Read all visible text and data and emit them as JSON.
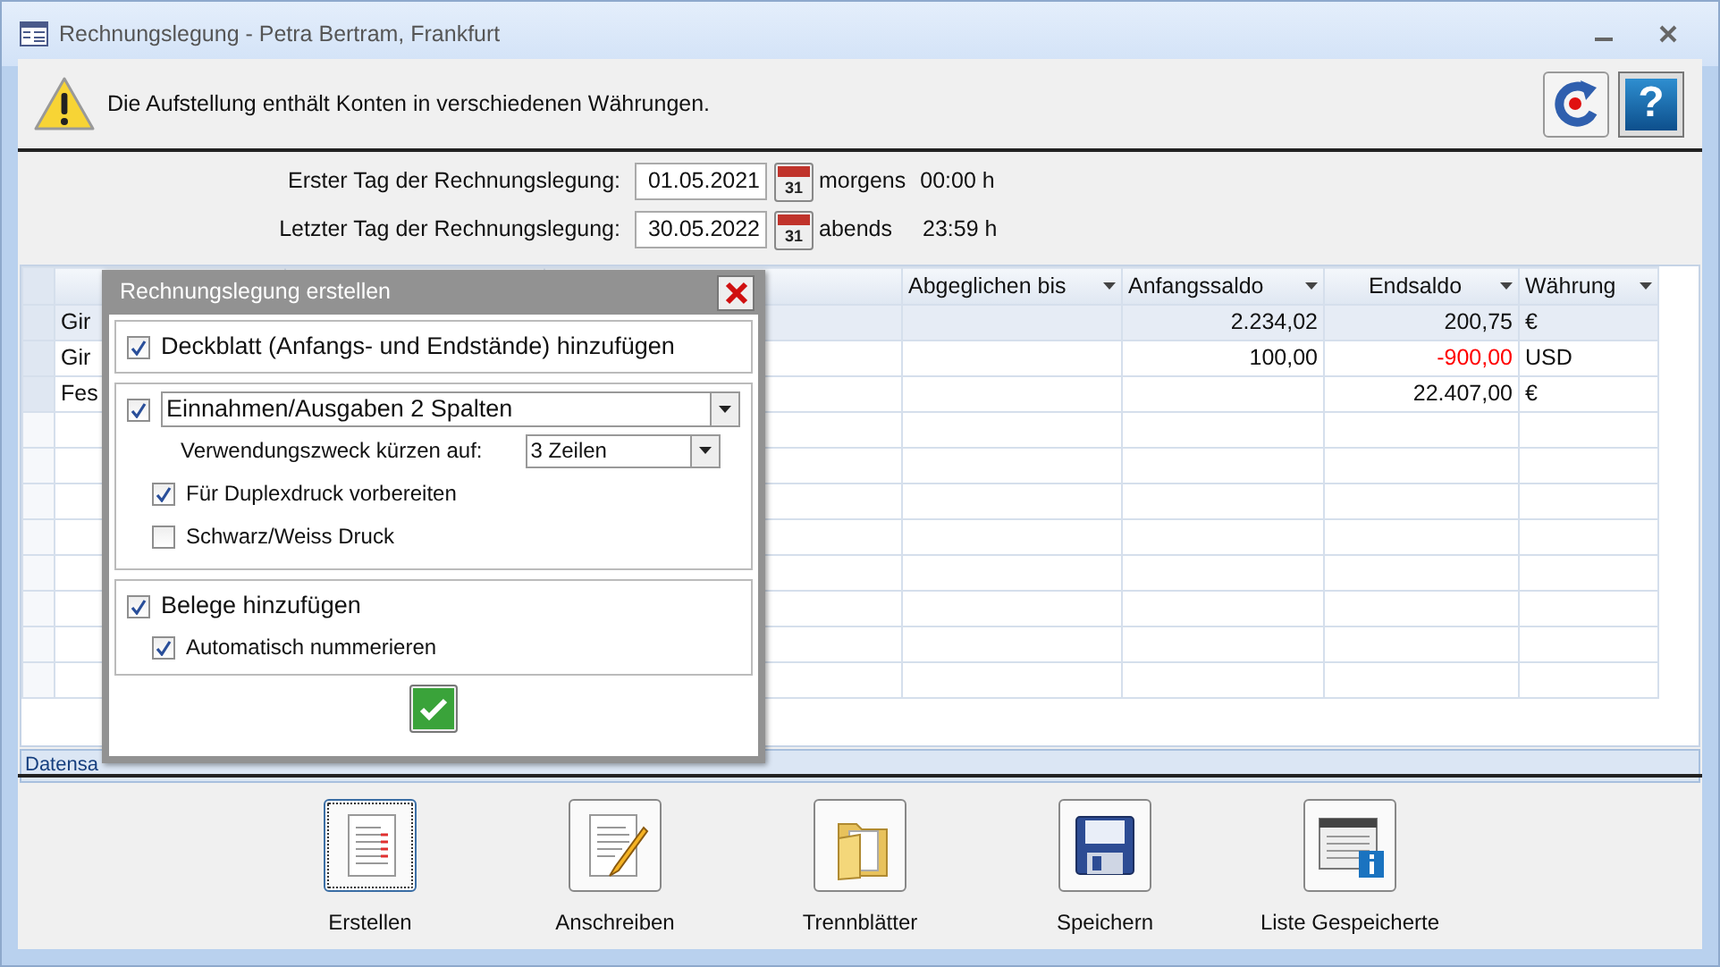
{
  "window": {
    "title": "Rechnungslegung - Petra Bertram, Frankfurt"
  },
  "warning": "Die Aufstellung enthält Konten in verschiedenen Währungen.",
  "help_button": "?",
  "period": [
    {
      "label": "Erster Tag der Rechnungslegung:",
      "date": "01.05.2021",
      "calendar": "31",
      "daytime": "morgens",
      "time": "00:00 h"
    },
    {
      "label": "Letzter Tag der Rechnungslegung:",
      "date": "30.05.2022",
      "calendar": "31",
      "daytime": "abends",
      "time": "23:59 h"
    }
  ],
  "table": {
    "columns": [
      "Abgeglichen bis",
      "Anfangssaldo",
      "Endsaldo",
      "Währung"
    ],
    "rows": [
      {
        "column_1": "Gir",
        "anfangssaldo": "2.234,02",
        "endsaldo": "200,75",
        "negative": false,
        "waehrung": "€",
        "selected": true
      },
      {
        "column_1": "Gir",
        "anfangssaldo": "100,00",
        "endsaldo": "-900,00",
        "negative": true,
        "waehrung": "USD",
        "selected": false
      },
      {
        "column_1": "Fes",
        "endsaldo": "22.407,00",
        "negative": false,
        "waehrung": "€",
        "selected": false
      }
    ]
  },
  "record_nav": {
    "label": "Datensa"
  },
  "dialog": {
    "title": "Rechnungslegung erstellen",
    "sections": [
      {
        "main": {
          "kind": "check",
          "label": "Deckblatt (Anfangs- und Endstände) hinzufügen",
          "checked": true
        }
      },
      {
        "main": {
          "kind": "check-select",
          "value": "Einnahmen/Ausgaben 2 Spalten",
          "checked": true
        },
        "children": [
          {
            "kind": "select",
            "label": "Verwendungszweck kürzen auf:",
            "value": "3 Zeilen"
          },
          {
            "kind": "check",
            "label": "Für Duplexdruck vorbereiten",
            "checked": true
          },
          {
            "kind": "check",
            "label": "Schwarz/Weiss Druck",
            "checked": false
          }
        ]
      },
      {
        "main": {
          "kind": "check",
          "label": "Belege hinzufügen",
          "checked": true
        },
        "children": [
          {
            "kind": "check",
            "label": "Automatisch nummerieren",
            "checked": true
          }
        ]
      }
    ]
  },
  "toolbar": [
    {
      "label": "Erstellen",
      "selected": true
    },
    {
      "label": "Anschreiben",
      "selected": false
    },
    {
      "label": "Trennblätter",
      "selected": false
    },
    {
      "label": "Speichern",
      "selected": false
    },
    {
      "label": "Liste Gespeicherte",
      "selected": false
    }
  ]
}
